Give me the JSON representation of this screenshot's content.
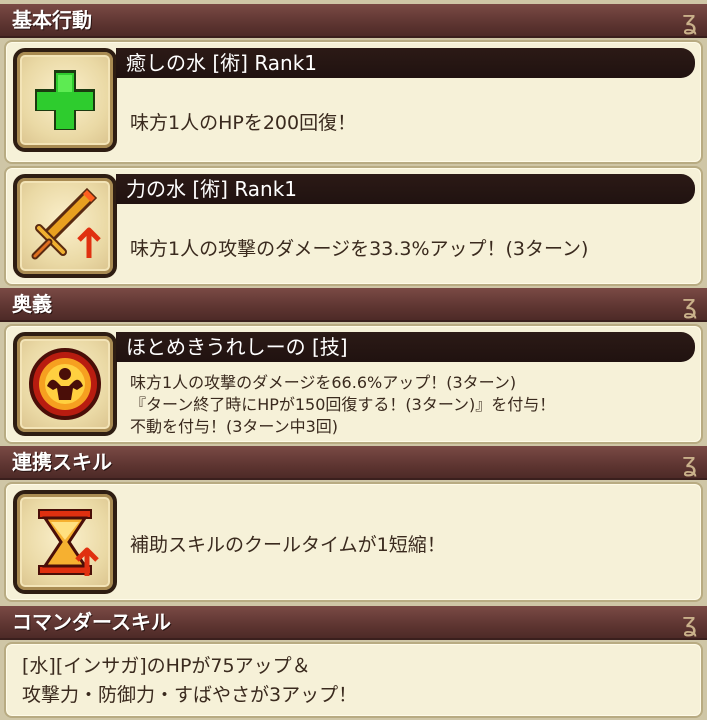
{
  "sections": {
    "basic": "基本行動",
    "ougi": "奥義",
    "renkei": "連携スキル",
    "commander": "コマンダースキル"
  },
  "skills": [
    {
      "title": "癒しの水 [術]  Rank1",
      "desc": "味方1人のHPを200回復！",
      "icon": "green-cross-heal-icon"
    },
    {
      "title": "力の水 [術]  Rank1",
      "desc": "味方1人の攻撃のダメージを33.3%アップ！(3ターン)",
      "icon": "sword-attack-up-icon"
    }
  ],
  "ougi": {
    "title": "ほとめきうれしーの [技]",
    "lines": [
      "味方1人の攻撃のダメージを66.6%アップ！(3ターン)",
      "『ターン終了時にHPが150回復する！(3ターン)』を付与！",
      "不動を付与！(3ターン中3回)"
    ],
    "icon": "muscle-emblem-icon"
  },
  "renkei": {
    "desc": "補助スキルのクールタイムが1短縮！",
    "icon": "hourglass-up-icon"
  },
  "commander": {
    "lines": [
      "[水][インサガ]のHPが75アップ＆",
      "攻撃力・防御力・すばやさが3アップ！"
    ]
  },
  "colors": {
    "header": "#5e3531",
    "card": "#f6f1d8",
    "title_bar": "#2c1a16"
  }
}
